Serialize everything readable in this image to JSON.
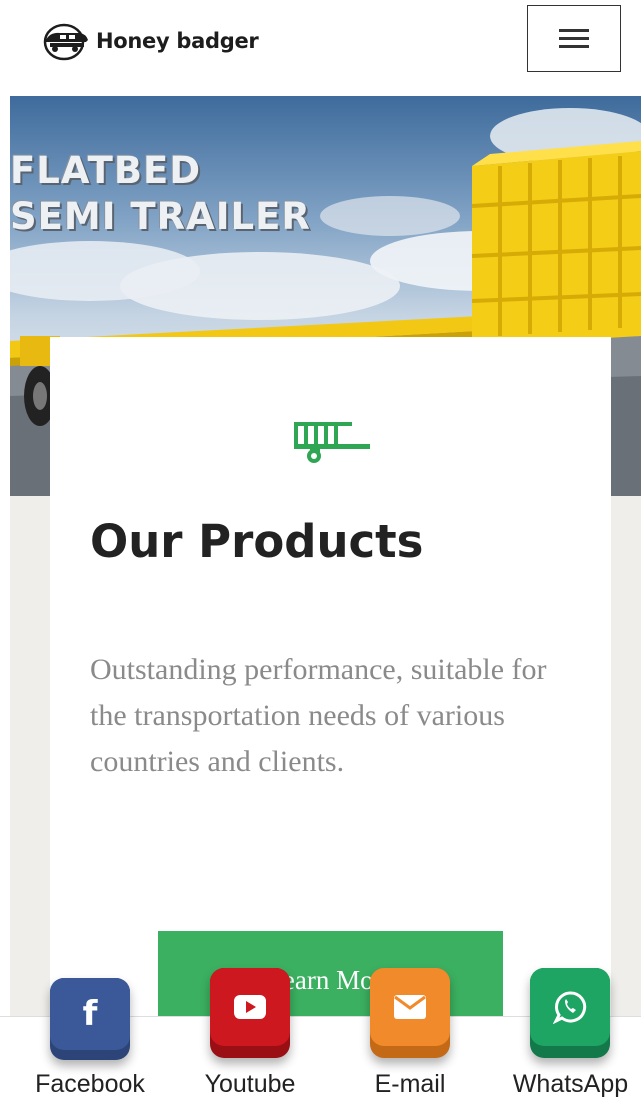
{
  "header": {
    "brand_name": "Honey badger",
    "logo_icon": "truck-badge-icon",
    "menu_icon": "hamburger-menu-icon"
  },
  "hero": {
    "title_line1": "FLATBED",
    "title_line2": "SEMI TRAILER"
  },
  "card": {
    "icon": "trailer-icon",
    "title": "Our Products",
    "description": "Outstanding performance, suitable for the transportation needs of various countries and clients.",
    "button_label": "Learn More"
  },
  "social": [
    {
      "label": "Facebook",
      "icon": "facebook-icon",
      "color": "#3b5998"
    },
    {
      "label": "Youtube",
      "icon": "youtube-icon",
      "color": "#cc181e"
    },
    {
      "label": "E-mail",
      "icon": "email-icon",
      "color": "#f08a2a"
    },
    {
      "label": "WhatsApp",
      "icon": "whatsapp-icon",
      "color": "#1ea463"
    }
  ],
  "colors": {
    "accent_green": "#3bb060",
    "title_text": "#222222",
    "body_text": "#8a8a8a"
  }
}
